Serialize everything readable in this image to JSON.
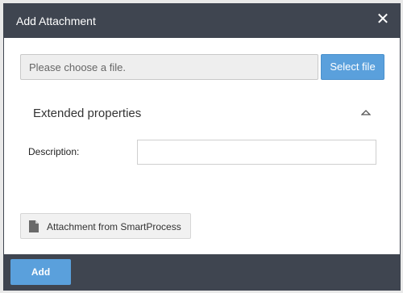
{
  "dialog": {
    "title": "Add Attachment",
    "close_icon": "close-icon"
  },
  "file": {
    "placeholder": "Please choose a file.",
    "select_label": "Select file"
  },
  "extended": {
    "title": "Extended properties",
    "toggle_icon": "chevron-up-icon"
  },
  "description": {
    "label": "Description:",
    "value": ""
  },
  "smartprocess": {
    "label": "Attachment from SmartProcess",
    "icon": "document-icon"
  },
  "footer": {
    "add_label": "Add"
  },
  "colors": {
    "header_bg": "#3f4550",
    "accent": "#5aa0dc"
  }
}
